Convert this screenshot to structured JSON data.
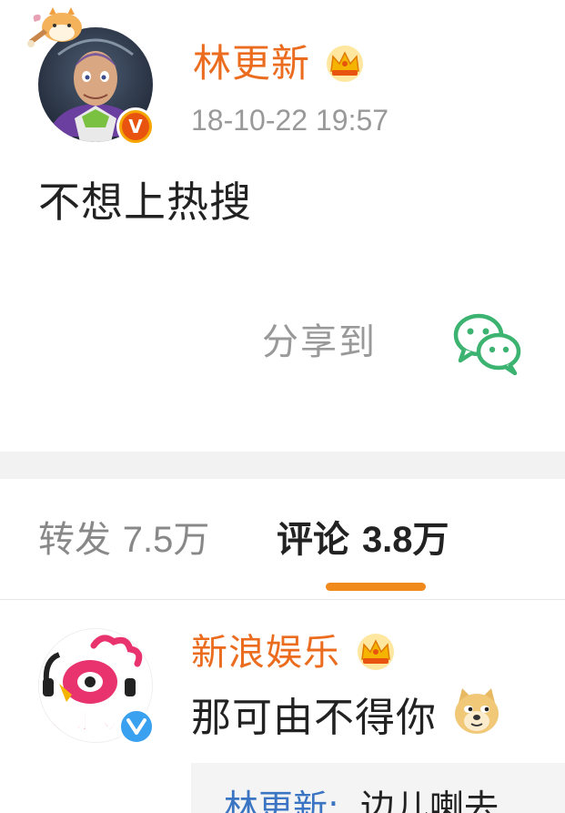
{
  "post": {
    "author": "林更新",
    "timestamp": "18-10-22 19:57",
    "text": "不想上热搜",
    "vip_badge": "V"
  },
  "share": {
    "label": "分享到",
    "target_icon": "wechat-icon"
  },
  "tabs": {
    "repost_label": "转发",
    "repost_count": "7.5万",
    "comment_label": "评论",
    "comment_count": "3.8万",
    "active": "comment"
  },
  "comment": {
    "author": "新浪娱乐",
    "text": "那可由不得你",
    "avatar_text": "新浪娱乐",
    "emoji": "doge-emoji"
  },
  "reply": {
    "author": "林更新:",
    "text": "边儿喇去"
  },
  "colors": {
    "username": "#eb6c1e",
    "accent_underline": "#f08a1c",
    "wechat_green": "#3cb371",
    "link_blue": "#3a74c2"
  }
}
